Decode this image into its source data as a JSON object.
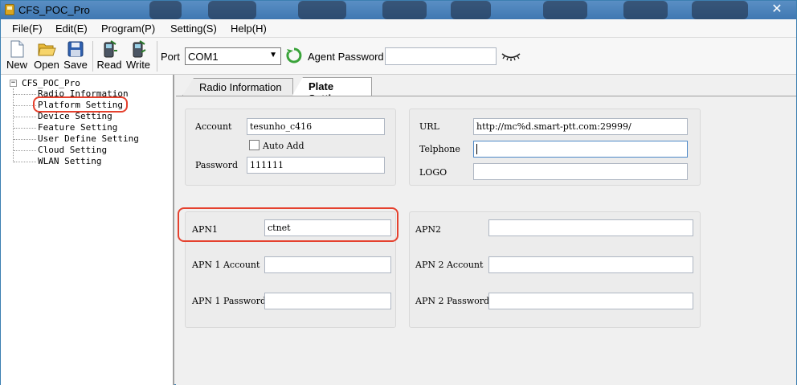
{
  "window": {
    "title": "CFS_POC_Pro",
    "close_glyph": "✕"
  },
  "menu": [
    "File(F)",
    "Edit(E)",
    "Program(P)",
    "Setting(S)",
    "Help(H)"
  ],
  "toolbar": {
    "new": "New",
    "open": "Open",
    "save": "Save",
    "read": "Read",
    "write": "Write",
    "port_label": "Port",
    "port_value": "COM1",
    "agent_password_label": "Agent Password",
    "agent_password_value": ""
  },
  "tree": {
    "root": "CFS_POC_Pro",
    "items": [
      "Radio Information",
      "Platform Setting",
      "Device Setting",
      "Feature Setting",
      "User Define Setting",
      "Cloud Setting",
      "WLAN Setting"
    ]
  },
  "tabs": [
    "Radio Information",
    "Plate Setting"
  ],
  "account_group": {
    "account_label": "Account",
    "account_value": "tesunho_c416",
    "auto_add_label": "Auto Add",
    "auto_add_checked": false,
    "password_label": "Password",
    "password_value": "111111"
  },
  "url_group": {
    "url_label": "URL",
    "url_value": "http://mc%d.smart-ptt.com:29999/",
    "telphone_label": "Telphone",
    "telphone_value": "",
    "logo_label": "LOGO",
    "logo_value": ""
  },
  "apn1_group": {
    "apn_label": "APN1",
    "apn_value": "ctnet",
    "account_label": "APN 1 Account",
    "account_value": "",
    "password_label": "APN 1 Password",
    "password_value": ""
  },
  "apn2_group": {
    "apn_label": "APN2",
    "apn_value": "",
    "account_label": "APN 2 Account",
    "account_value": "",
    "password_label": "APN 2 Password",
    "password_value": ""
  },
  "colors": {
    "highlight": "#e5412e",
    "titlebar": "#3f78b2"
  }
}
